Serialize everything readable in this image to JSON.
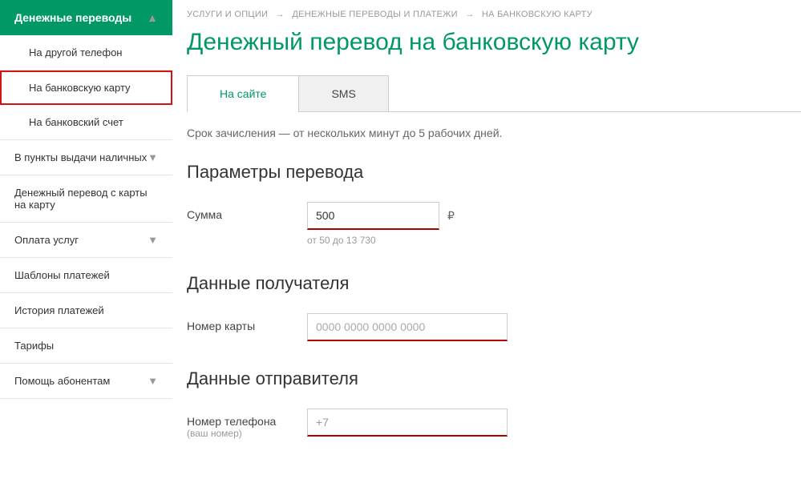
{
  "sidebar": {
    "header": "Денежные переводы",
    "items": [
      {
        "label": "На другой телефон",
        "level": "sub",
        "selected": false
      },
      {
        "label": "На банковскую карту",
        "level": "sub",
        "selected": true
      },
      {
        "label": "На банковский счет",
        "level": "sub",
        "selected": false
      },
      {
        "label": "В пункты выдачи наличных",
        "level": "top",
        "chev": true
      },
      {
        "label": "Денежный перевод с карты на карту",
        "level": "top",
        "chev": false
      },
      {
        "label": "Оплата услуг",
        "level": "top",
        "chev": true
      },
      {
        "label": "Шаблоны платежей",
        "level": "top",
        "chev": false
      },
      {
        "label": "История платежей",
        "level": "top",
        "chev": false
      },
      {
        "label": "Тарифы",
        "level": "top",
        "chev": false
      },
      {
        "label": "Помощь абонентам",
        "level": "top",
        "chev": true
      }
    ]
  },
  "breadcrumb": [
    "УСЛУГИ И ОПЦИИ",
    "ДЕНЕЖНЫЕ ПЕРЕВОДЫ И ПЛАТЕЖИ",
    "НА БАНКОВСКУЮ КАРТУ"
  ],
  "page_title": "Денежный перевод на банковскую карту",
  "tabs": [
    {
      "label": "На сайте",
      "active": true
    },
    {
      "label": "SMS",
      "active": false
    }
  ],
  "note": "Срок зачисления — от нескольких минут до 5 рабочих дней.",
  "section1_title": "Параметры перевода",
  "amount": {
    "label": "Сумма",
    "value": "500",
    "currency": "₽",
    "range": "от 50 до 13 730"
  },
  "section2_title": "Данные получателя",
  "card": {
    "label": "Номер карты",
    "placeholder": "0000 0000 0000 0000"
  },
  "section3_title": "Данные отправителя",
  "phone": {
    "label": "Номер телефона",
    "hint": "(ваш номер)",
    "value": "+7"
  }
}
